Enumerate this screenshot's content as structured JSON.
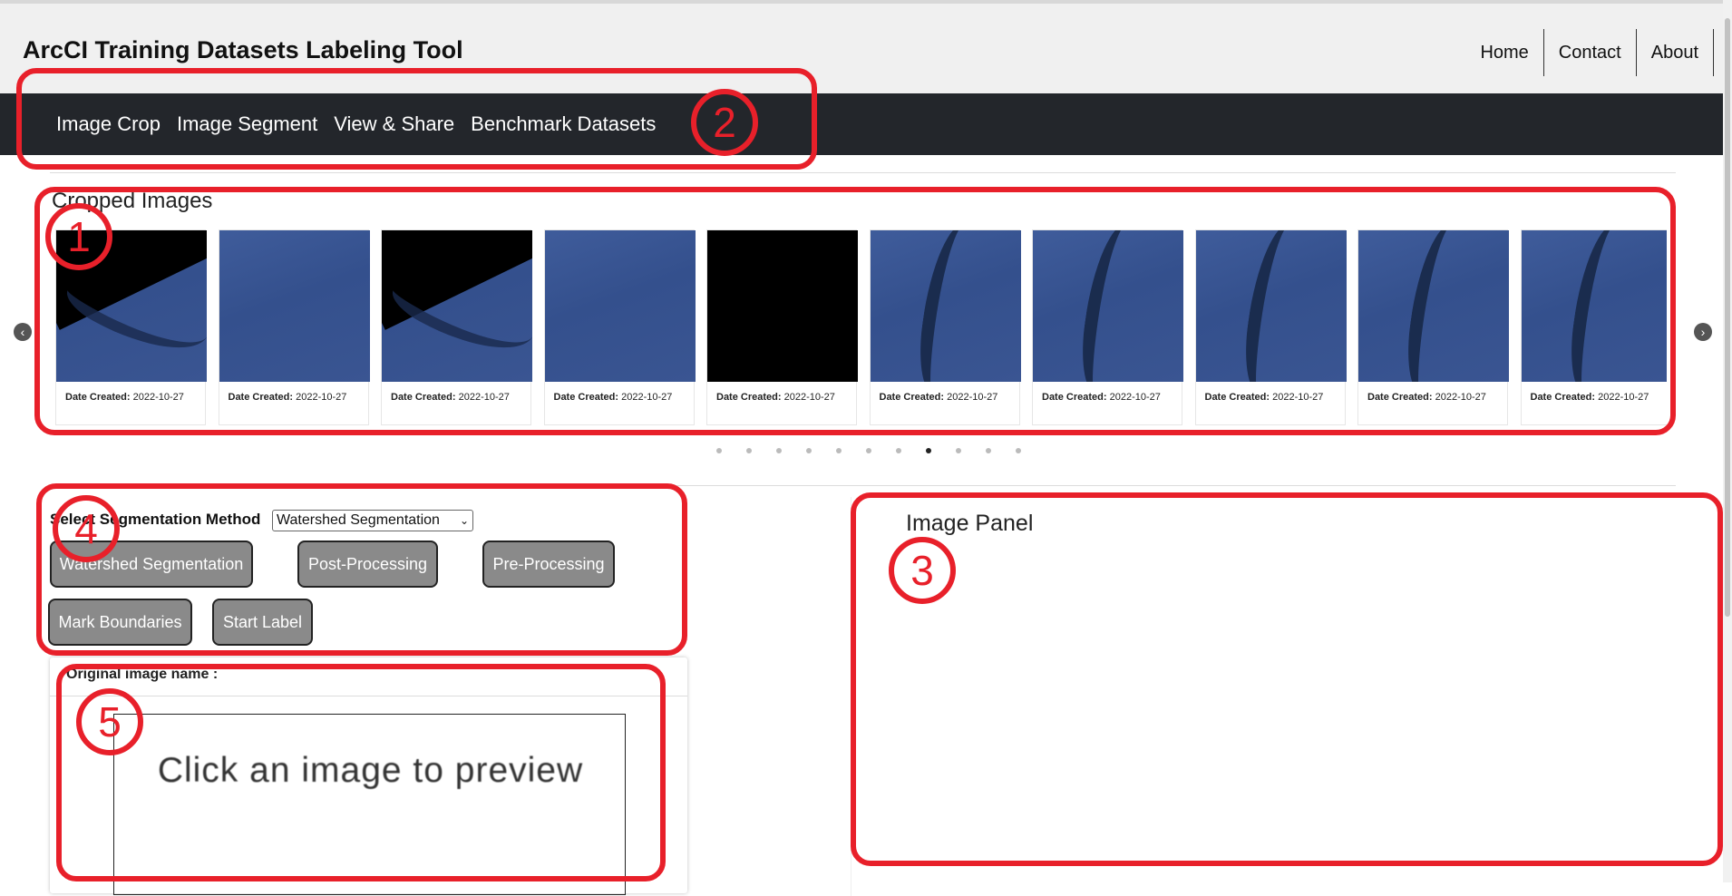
{
  "app": {
    "title": "ArcCI Training Datasets Labeling Tool"
  },
  "topnav": [
    "Home",
    "Contact",
    "About"
  ],
  "mainmenu": [
    "Image Crop",
    "Image Segment",
    "View & Share",
    "Benchmark Datasets"
  ],
  "carousel": {
    "heading": "Cropped Images",
    "cards": [
      {
        "thumb": "ice-black-corner",
        "label": "Date Created:",
        "date": "2022-10-27"
      },
      {
        "thumb": "ice-plain",
        "label": "Date Created:",
        "date": "2022-10-27"
      },
      {
        "thumb": "ice-black-corner",
        "label": "Date Created:",
        "date": "2022-10-27"
      },
      {
        "thumb": "ice-plain",
        "label": "Date Created:",
        "date": "2022-10-27"
      },
      {
        "thumb": "black",
        "label": "Date Created:",
        "date": "2022-10-27"
      },
      {
        "thumb": "ice-crack",
        "label": "Date Created:",
        "date": "2022-10-27"
      },
      {
        "thumb": "ice-crack",
        "label": "Date Created:",
        "date": "2022-10-27"
      },
      {
        "thumb": "ice-crack",
        "label": "Date Created:",
        "date": "2022-10-27"
      },
      {
        "thumb": "ice-crack",
        "label": "Date Created:",
        "date": "2022-10-27"
      },
      {
        "thumb": "ice-crack",
        "label": "Date Created:",
        "date": "2022-10-27"
      }
    ],
    "prev_icon": "chevron-left-icon",
    "next_icon": "chevron-right-icon",
    "dot_count": 11,
    "active_dot": 7
  },
  "segmentation": {
    "label": "Select Segmentation Method",
    "selected": "Watershed Segmentation",
    "buttons": [
      "Watershed Segmentation",
      "Post-Processing",
      "Pre-Processing",
      "Mark Boundaries",
      "Start Label"
    ]
  },
  "preview": {
    "name_label": "Original image name :",
    "placeholder": "Click an image to preview"
  },
  "image_panel": {
    "title": "Image Panel"
  },
  "annotations": [
    "1",
    "2",
    "3",
    "4",
    "5"
  ],
  "colors": {
    "menu_bg": "#23262b",
    "header_bg": "#f0f0f0",
    "button_bg": "#8a8a8a",
    "annotation_red": "#e8202a",
    "ice_blue": "#3a5592"
  }
}
